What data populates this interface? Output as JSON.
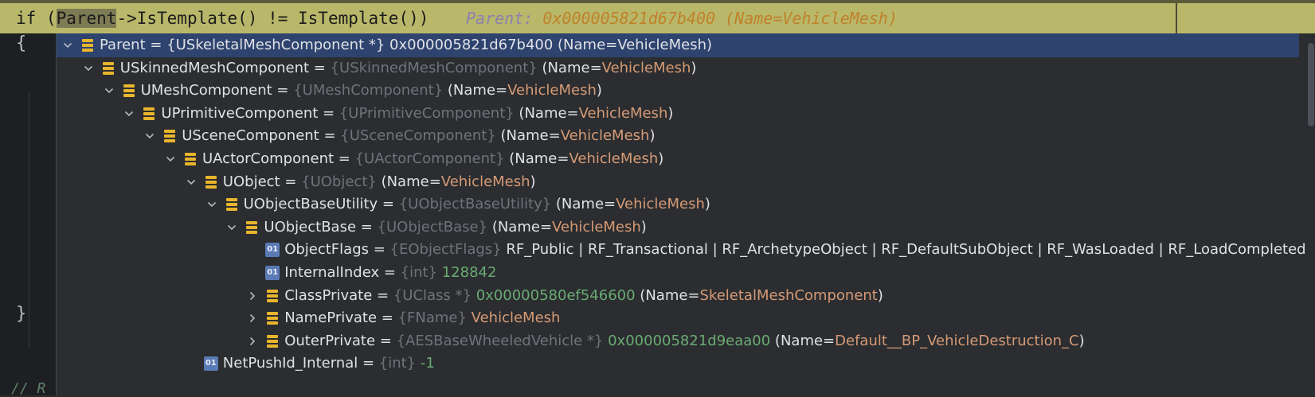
{
  "code": {
    "before": "if (",
    "highlight": "Parent",
    "after": "->IsTemplate() != IsTemplate())",
    "hint_label": "Parent:",
    "hint_value": "0x000005821d67b400 (Name=VehicleMesh)"
  },
  "editor": {
    "open_brace": "{",
    "close_brace": "}",
    "comment_fragment": "// R"
  },
  "rows": [
    {
      "indent": 0,
      "chevron": "down",
      "icon": "struct",
      "name": "Parent",
      "type": "",
      "value": "{USkeletalMeshComponent *} 0x000005821d67b400 (Name=VehicleMesh)",
      "value_class": "t-plain",
      "selected": true
    },
    {
      "indent": 1,
      "chevron": "down",
      "icon": "struct",
      "name": "USkinnedMeshComponent",
      "type": "{USkinnedMeshComponent}",
      "pre": "(Name=",
      "str": "VehicleMesh",
      "post": ")"
    },
    {
      "indent": 2,
      "chevron": "down",
      "icon": "struct",
      "name": "UMeshComponent",
      "type": "{UMeshComponent}",
      "pre": "(Name=",
      "str": "VehicleMesh",
      "post": ")"
    },
    {
      "indent": 3,
      "chevron": "down",
      "icon": "struct",
      "name": "UPrimitiveComponent",
      "type": "{UPrimitiveComponent}",
      "pre": "(Name=",
      "str": "VehicleMesh",
      "post": ")"
    },
    {
      "indent": 4,
      "chevron": "down",
      "icon": "struct",
      "name": "USceneComponent",
      "type": "{USceneComponent}",
      "pre": "(Name=",
      "str": "VehicleMesh",
      "post": ")"
    },
    {
      "indent": 5,
      "chevron": "down",
      "icon": "struct",
      "name": "UActorComponent",
      "type": "{UActorComponent}",
      "pre": "(Name=",
      "str": "VehicleMesh",
      "post": ")"
    },
    {
      "indent": 6,
      "chevron": "down",
      "icon": "struct",
      "name": "UObject",
      "type": "{UObject}",
      "pre": "(Name=",
      "str": "VehicleMesh",
      "post": ")"
    },
    {
      "indent": 7,
      "chevron": "down",
      "icon": "struct",
      "name": "UObjectBaseUtility",
      "type": "{UObjectBaseUtility}",
      "pre": "(Name=",
      "str": "VehicleMesh",
      "post": ")"
    },
    {
      "indent": 8,
      "chevron": "down",
      "icon": "struct",
      "name": "UObjectBase",
      "type": "{UObjectBase}",
      "pre": "(Name=",
      "str": "VehicleMesh",
      "post": ")"
    },
    {
      "indent": 9,
      "chevron": "none",
      "icon": "prim",
      "name": "ObjectFlags",
      "type": "{EObjectFlags}",
      "pre": "RF_Public | RF_Transactional | RF_ArchetypeObject | RF_DefaultSubObject | RF_WasLoaded | RF_LoadCompleted",
      "str": "",
      "post": ""
    },
    {
      "indent": 9,
      "chevron": "none",
      "icon": "prim",
      "name": "InternalIndex",
      "type": "{int}",
      "num": "128842"
    },
    {
      "indent": 9,
      "chevron": "right",
      "icon": "struct",
      "name": "ClassPrivate",
      "type": "{UClass *}",
      "num": "0x00000580ef546600",
      "pre": " (Name=",
      "str": "SkeletalMeshComponent",
      "post": ")"
    },
    {
      "indent": 9,
      "chevron": "right",
      "icon": "struct",
      "name": "NamePrivate",
      "type": "{FName}",
      "pre": "",
      "str": "VehicleMesh",
      "post": ""
    },
    {
      "indent": 9,
      "chevron": "right",
      "icon": "struct",
      "name": "OuterPrivate",
      "type": "{AESBaseWheeledVehicle *}",
      "num": "0x000005821d9eaa00",
      "pre": " (Name=",
      "str": "Default__BP_VehicleDestruction_C",
      "post": ")"
    },
    {
      "indent": 6,
      "chevron": "none",
      "icon": "prim",
      "name": "NetPushId_Internal",
      "type": "{int}",
      "num": "-1"
    }
  ],
  "icon_prim_text": "01",
  "colors": {
    "selection": "#2e436e",
    "type_gray": "#6f737a",
    "string_orange": "#d69a75",
    "number_green": "#6aab73",
    "struct_yellow": "#e8b52c",
    "prim_blue": "#5a7ab6",
    "code_highlight_bg": "#b9b86a"
  }
}
